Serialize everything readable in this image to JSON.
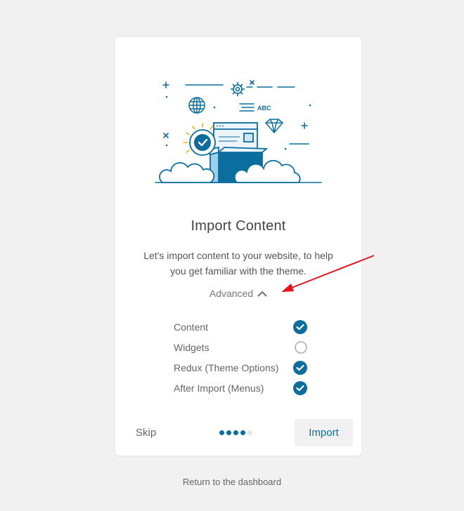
{
  "card": {
    "title": "Import Content",
    "description": "Let's import content to your website, to help you get familiar with the theme.",
    "advanced_label": "Advanced",
    "illustration_text": "ABC",
    "options": [
      {
        "label": "Content",
        "checked": true
      },
      {
        "label": "Widgets",
        "checked": false
      },
      {
        "label": "Redux (Theme Options)",
        "checked": true
      },
      {
        "label": "After Import (Menus)",
        "checked": true
      }
    ]
  },
  "footer": {
    "skip_label": "Skip",
    "import_label": "Import",
    "steps_total": 5,
    "steps_done": 4
  },
  "return_link": "Return to the dashboard",
  "colors": {
    "accent": "#0b6e9e",
    "background": "#f1f1f1",
    "annotation_arrow": "#e8141b"
  },
  "icons": [
    "gear-icon",
    "globe-icon",
    "diamond-icon",
    "checkmark-badge-icon",
    "chevron-up-icon",
    "check-icon",
    "red-arrow-annotation"
  ]
}
